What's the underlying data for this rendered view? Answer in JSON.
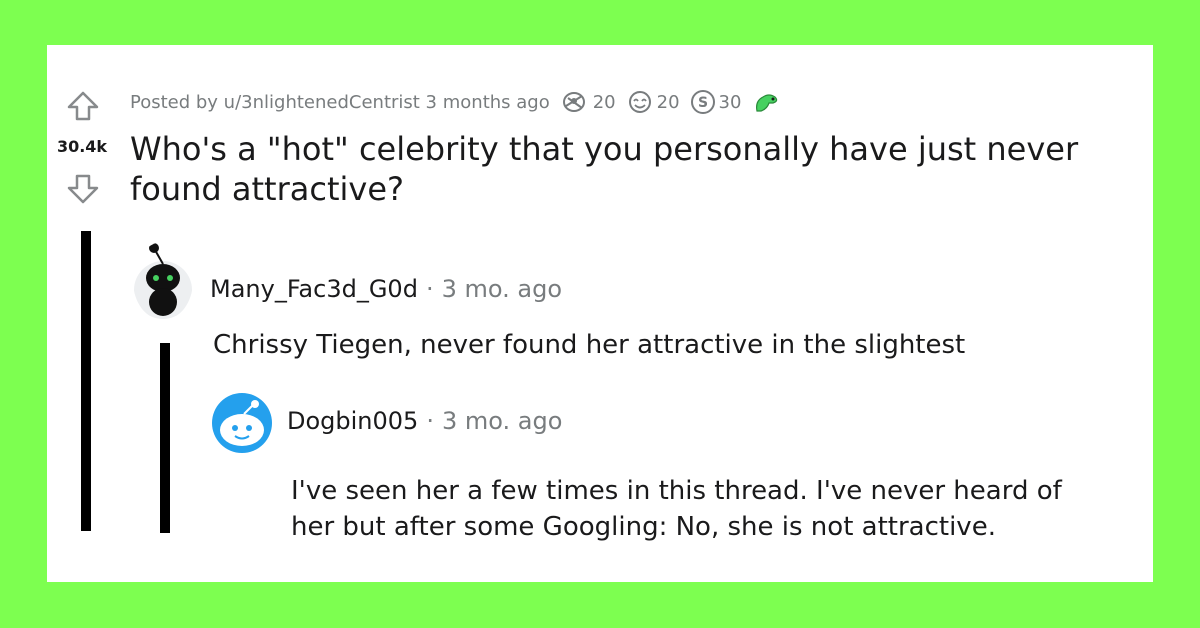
{
  "post": {
    "score": "30.4k",
    "posted_by": "Posted by u/3nlightenedCentrist 3 months ago",
    "awards": [
      {
        "icon": "helpful-award-icon",
        "count": "20"
      },
      {
        "icon": "wholesome-award-icon",
        "count": "20"
      },
      {
        "icon": "silver-award-icon",
        "count": "30"
      },
      {
        "icon": "dino-award-icon",
        "count": ""
      }
    ],
    "title": "Who's a \"hot\" celebrity that you personally have just never found attractive?"
  },
  "comments": [
    {
      "author": "Many_Fac3d_G0d",
      "separator": "·",
      "time": "3 mo. ago",
      "text": "Chrissy Tiegen, never found her attractive in the slightest"
    },
    {
      "author": "Dogbin005",
      "separator": "·",
      "time": "3 mo. ago",
      "text": "I've seen her a few times in this thread. I've never heard of her but after some Googling: No, she is not attractive."
    }
  ],
  "colors": {
    "background": "#7dff50",
    "card": "#ffffff",
    "text": "#1a1a1b",
    "muted": "#787c7e",
    "avatar_blue": "#24a0ed"
  }
}
